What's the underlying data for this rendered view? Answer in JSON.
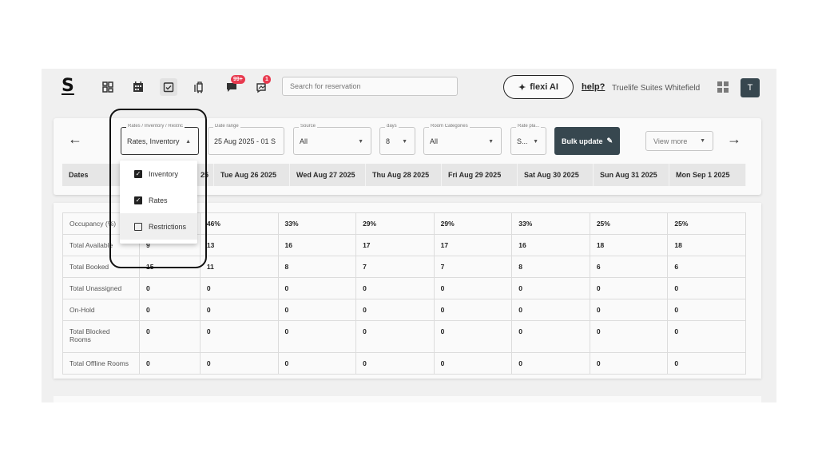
{
  "nav": {
    "logo": "S",
    "chat_badge": "99+",
    "notif_badge": "1",
    "search_placeholder": "Search for reservation",
    "flexi_label": "flexi AI",
    "help_label": "help?",
    "hotel_name": "Truelife Suites Whitefield",
    "avatar_initial": "T"
  },
  "filters": {
    "view": {
      "label": "Rates / Inventory / Restric",
      "value": "Rates, Inventory"
    },
    "date_range": {
      "label": "Date range",
      "value": "25 Aug 2025 - 01 S"
    },
    "source": {
      "label": "Source",
      "value": "All"
    },
    "days": {
      "label": "days",
      "value": "8"
    },
    "room_categories": {
      "label": "Room Categories",
      "value": "All"
    },
    "rate_plan": {
      "label": "Rate pla...",
      "value": "S..."
    },
    "bulk_update": "Bulk update",
    "view_more": "View more"
  },
  "dropdown": {
    "options": [
      {
        "label": "Inventory",
        "checked": true
      },
      {
        "label": "Rates",
        "checked": true
      },
      {
        "label": "Restrictions",
        "checked": false
      }
    ]
  },
  "header": {
    "dates_label": "Dates",
    "hidden_date_tail": "25",
    "columns": [
      "Tue Aug 26 2025",
      "Wed Aug 27 2025",
      "Thu Aug 28 2025",
      "Fri Aug 29 2025",
      "Sat Aug 30 2025",
      "Sun Aug 31 2025",
      "Mon Sep 1 2025"
    ]
  },
  "rows": [
    {
      "label": "Occupancy (%)",
      "values": [
        "",
        "46%",
        "33%",
        "29%",
        "29%",
        "33%",
        "25%",
        "25%"
      ]
    },
    {
      "label": "Total Available",
      "values": [
        "9",
        "13",
        "16",
        "17",
        "17",
        "16",
        "18",
        "18"
      ]
    },
    {
      "label": "Total Booked",
      "values": [
        "15",
        "11",
        "8",
        "7",
        "7",
        "8",
        "6",
        "6"
      ]
    },
    {
      "label": "Total Unassigned",
      "values": [
        "0",
        "0",
        "0",
        "0",
        "0",
        "0",
        "0",
        "0"
      ]
    },
    {
      "label": "On-Hold",
      "values": [
        "0",
        "0",
        "0",
        "0",
        "0",
        "0",
        "0",
        "0"
      ]
    },
    {
      "label": "Total Blocked Rooms",
      "values": [
        "0",
        "0",
        "0",
        "0",
        "0",
        "0",
        "0",
        "0"
      ]
    },
    {
      "label": "Total Offline Rooms",
      "values": [
        "0",
        "0",
        "0",
        "0",
        "0",
        "0",
        "0",
        "0"
      ]
    }
  ]
}
